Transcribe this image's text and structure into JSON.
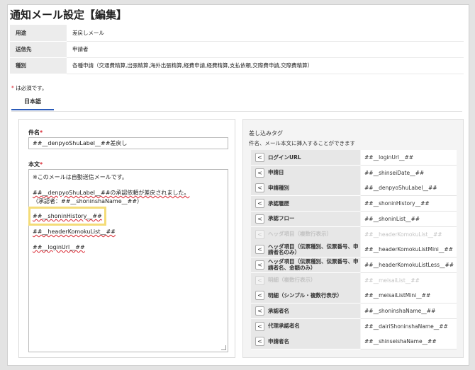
{
  "page": {
    "title": "通知メール設定【編集】"
  },
  "info": [
    {
      "label": "用途",
      "value": "差戻しメール"
    },
    {
      "label": "送信先",
      "value": "申請者"
    },
    {
      "label": "種別",
      "value": "各種申請（交通費精算,出張精算,海外出張精算,経費申請,経費精算,支払依頼,交際費申請,交際費精算）"
    }
  ],
  "required_note": {
    "star": "*",
    "text": "は必須です。"
  },
  "tabs": [
    {
      "label": "日本語"
    }
  ],
  "form": {
    "subject_label": "件名",
    "required_mark": "*",
    "subject_value": "##__denpyoShuLabel__##差戻し",
    "body_label": "本文",
    "body_lines": [
      "※このメールは自動送信メールです。",
      "##__denpyoShuLabel__##の承認依頼が差戻されました。",
      "（承認者：##__shoninshaName__##）",
      "##__shoninHistory__##",
      "##__headerKomokuList__##",
      "##__loginUrl__##"
    ]
  },
  "tags_panel": {
    "title": "差し込みタグ",
    "subtitle": "件名、メール本文に挿入することができます",
    "insert_glyph": "<",
    "tags": [
      {
        "name": "ログインURL",
        "tag": "##__loginUrl__##",
        "enabled": true
      },
      {
        "name": "申請日",
        "tag": "##__shinseiDate__##",
        "enabled": true
      },
      {
        "name": "申請種別",
        "tag": "##__denpyoShuLabel__##",
        "enabled": true
      },
      {
        "name": "承認履歴",
        "tag": "##__shoninHistory__##",
        "enabled": true
      },
      {
        "name": "承認フロー",
        "tag": "##__shoninList__##",
        "enabled": true
      },
      {
        "name": "ヘッダ項目（複数行表示）",
        "tag": "##__headerKomokuList__##",
        "enabled": false
      },
      {
        "name": "ヘッダ項目（伝票種別、伝票番号、申請者名のみ）",
        "tag": "##__headerKomokuListMini__##",
        "enabled": true
      },
      {
        "name": "ヘッダ項目（伝票種別、伝票番号、申請者名、金額のみ）",
        "tag": "##__headerKomokuListLess__##",
        "enabled": true
      },
      {
        "name": "明細（複数行表示）",
        "tag": "##__meisaiList__##",
        "enabled": false
      },
      {
        "name": "明細（シンプル・複数行表示）",
        "tag": "##__meisaiListMini__##",
        "enabled": true
      },
      {
        "name": "承認者名",
        "tag": "##__shoninshaName__##",
        "enabled": true
      },
      {
        "name": "代理承認者名",
        "tag": "##__dairiShoninshaName__##",
        "enabled": true
      },
      {
        "name": "申請者名",
        "tag": "##__shinseishaName__##",
        "enabled": true
      }
    ]
  }
}
